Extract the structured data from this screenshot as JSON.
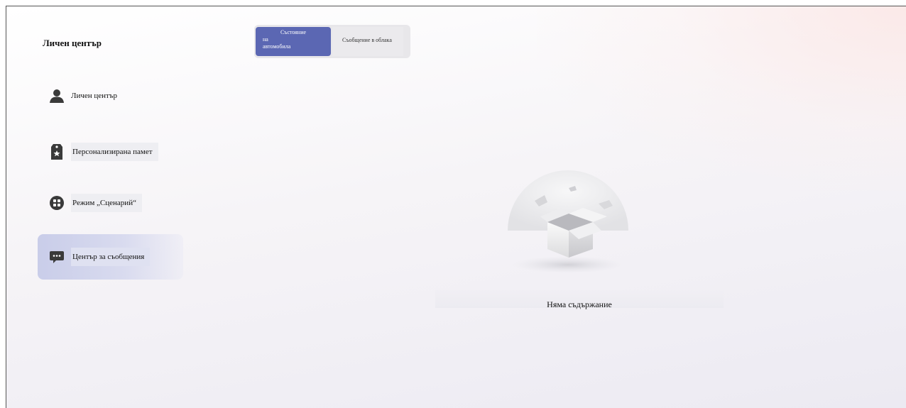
{
  "app": {
    "title": "Личен център"
  },
  "sidebar": {
    "items": [
      {
        "label": "Личен център",
        "icon": "person-icon",
        "active": false
      },
      {
        "label": "Персонализирана памет",
        "icon": "memory-tag-icon",
        "active": false
      },
      {
        "label": "Режим „Сценарий“",
        "icon": "scenario-grid-icon",
        "active": false
      },
      {
        "label": "Център за съобщения",
        "icon": "message-icon",
        "active": true
      }
    ]
  },
  "tabs": [
    {
      "label_line1": "Състояние",
      "label_line2": "на",
      "label_line3": "автомобила",
      "active": true
    },
    {
      "label": "Съобщение в облака",
      "active": false
    }
  ],
  "main": {
    "empty_text": "Няма съдържание"
  },
  "colors": {
    "accent": "#5b67b3",
    "active_item_bg": "#c9cde9",
    "icon": "#3a3a3a"
  }
}
